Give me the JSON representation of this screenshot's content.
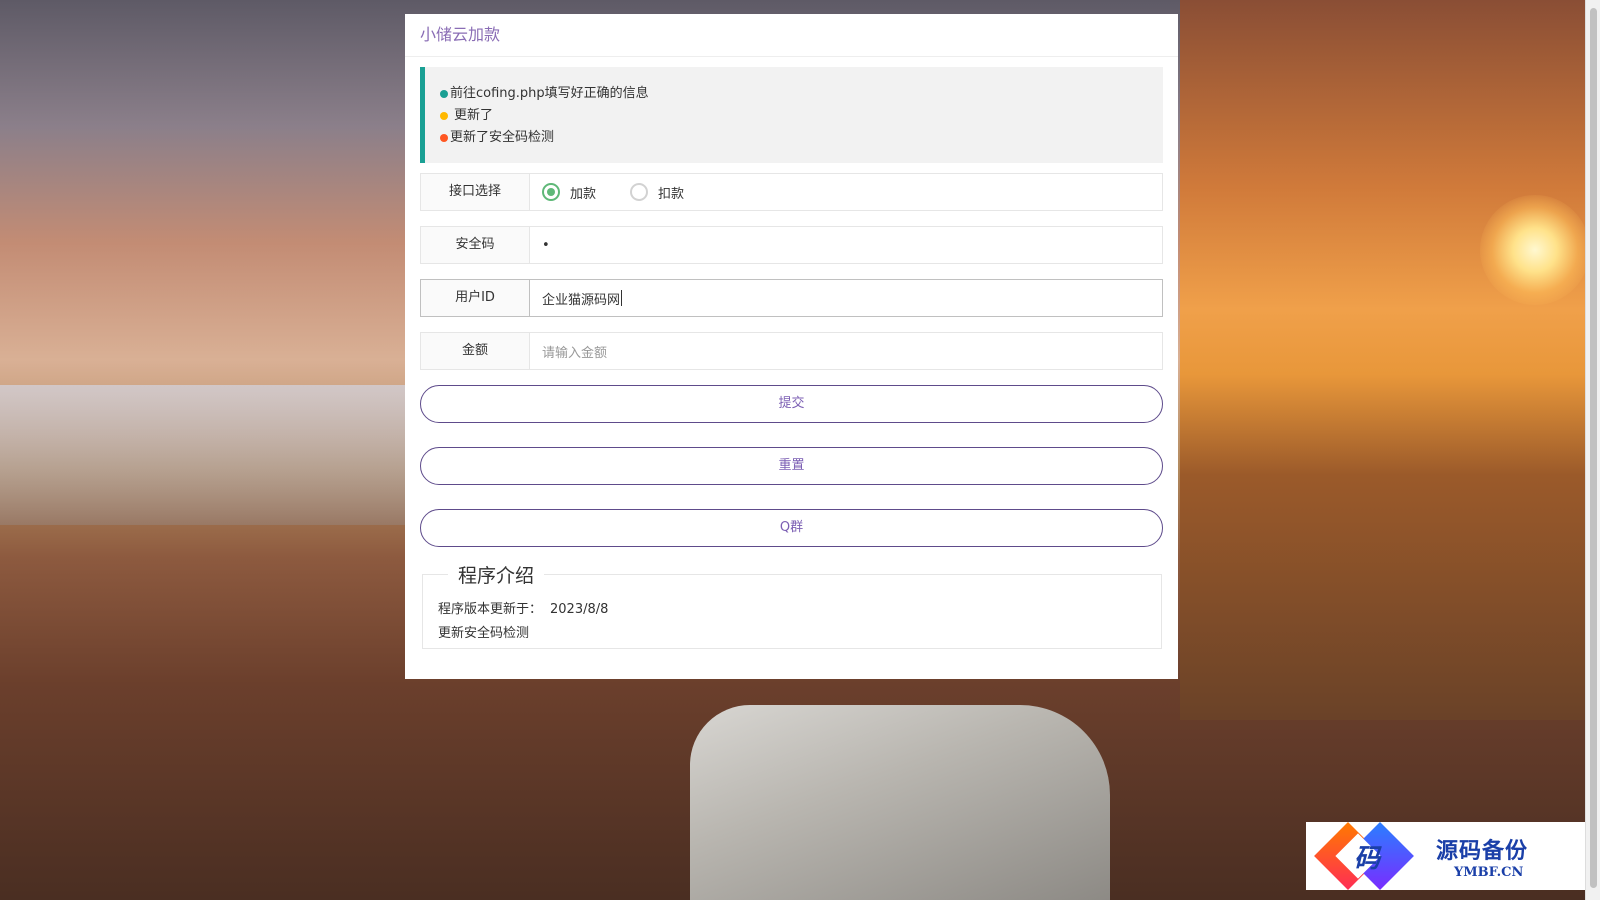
{
  "panel": {
    "title": "小储云加款"
  },
  "notices": [
    {
      "text": "前往cofing.php填写好正确的信息",
      "color": "#1aa094"
    },
    {
      "text": "更新了",
      "color": "#ffb800"
    },
    {
      "text": "更新了安全码检测",
      "color": "#ff5722"
    }
  ],
  "form": {
    "interface": {
      "label": "接口选择",
      "options": [
        {
          "label": "加款",
          "selected": true
        },
        {
          "label": "扣款",
          "selected": false
        }
      ]
    },
    "security_code": {
      "label": "安全码",
      "value": "•"
    },
    "user_id": {
      "label": "用户ID",
      "value": "企业猫源码网"
    },
    "amount": {
      "label": "金额",
      "placeholder": "请输入金额",
      "value": ""
    }
  },
  "buttons": {
    "submit": "提交",
    "reset": "重置",
    "qgroup": "Q群"
  },
  "intro": {
    "legend": "程序介绍",
    "version_label": "程序版本更新于：",
    "version_date": "2023/8/8",
    "note": "更新安全码检测"
  },
  "watermark": {
    "char": "码",
    "title": "源码备份",
    "site": "YMBF.CN"
  },
  "colors": {
    "accent": "#7b5eb3",
    "radio_on": "#5fb878",
    "notice_border": "#1aa094"
  }
}
